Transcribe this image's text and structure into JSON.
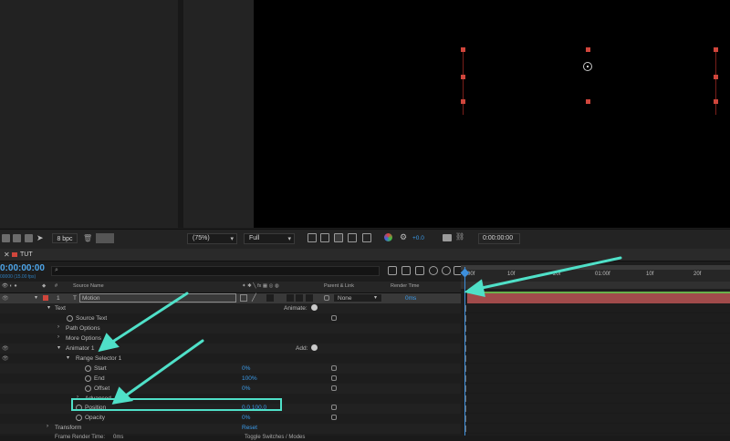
{
  "toolbar": {
    "bit_depth": "8 bpc",
    "zoom": "(75%)",
    "resolution": "Full",
    "exposure": "+0.0",
    "timecode": "0:00:00:00"
  },
  "timeline": {
    "tab_label": "TUT",
    "current_time": "0:00:00:00",
    "fps_label": "00000 (15.00 fps)",
    "columns": {
      "number": "#",
      "source_name": "Source Name",
      "parent_link": "Parent & Link",
      "render_time": "Render Time"
    },
    "ruler_ticks": [
      "00f",
      "10f",
      "20f",
      "01:00f",
      "10f",
      "20f"
    ],
    "layer": {
      "index": "1",
      "type": "T",
      "name": "Motion",
      "parent": "None",
      "render_time": "0ms"
    },
    "rows": {
      "text": "Text",
      "animate_label": "Animate:",
      "source_text": "Source Text",
      "path_options": "Path Options",
      "more_options": "More Options",
      "animator": "Animator 1",
      "add_label": "Add:",
      "range_selector": "Range Selector 1",
      "start": "Start",
      "start_value": "0%",
      "end": "End",
      "end_value": "100%",
      "offset": "Offset",
      "offset_value": "0%",
      "advanced": "Advanced",
      "position": "Position",
      "position_value": "0.0,100.0",
      "opacity": "Opacity",
      "opacity_value": "0%",
      "transform": "Transform",
      "transform_value": "Reset"
    },
    "status": {
      "frame_render": "Frame Render Time:",
      "frame_render_value": "0ms",
      "toggle": "Toggle Switches / Modes"
    }
  },
  "colors": {
    "accent_blue": "#3b9bea",
    "layer_label": "#d0463c",
    "annotation": "#4fe0c8"
  }
}
